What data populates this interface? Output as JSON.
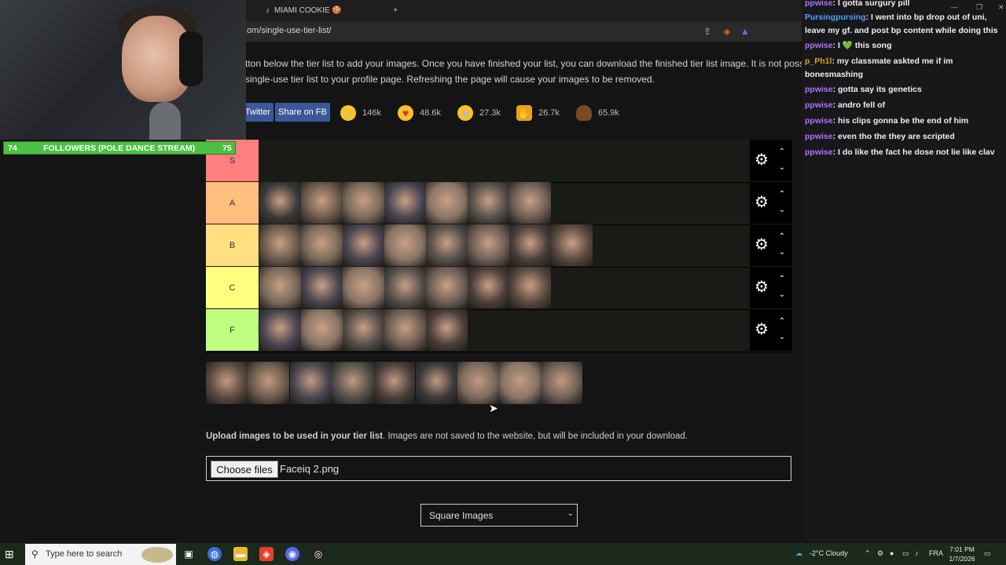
{
  "browser": {
    "tabs": [
      {
        "label": "MIAMI COOKIE 🍪 (@unbancookie)"
      }
    ],
    "url": "om/single-use-tier-list/"
  },
  "page": {
    "intro_line1": "tton below the tier list to add your images. Once you have finished your list, you can download the finished tier list image. It is not possible",
    "intro_line2": "single-use tier list to your profile page. Refreshing the page will cause your images to be removed.",
    "share_twitter": "Twitter",
    "share_fb": "Share on FB",
    "reactions": [
      {
        "icon": "smile-emoji-icon",
        "count": "146k"
      },
      {
        "icon": "heart-eyes-emoji-icon",
        "count": "48.6k"
      },
      {
        "icon": "laughing-emoji-icon",
        "count": "27.3k"
      },
      {
        "icon": "raised-hands-emoji-icon",
        "count": "26.7k"
      },
      {
        "icon": "poop-emoji-icon",
        "count": "65.9k"
      }
    ],
    "tiers": [
      {
        "label": "S",
        "color": "#ff7f7f",
        "count": 0
      },
      {
        "label": "A",
        "color": "#ffbf7f",
        "count": 7
      },
      {
        "label": "B",
        "color": "#ffdf7f",
        "count": 8
      },
      {
        "label": "C",
        "color": "#ffff7f",
        "count": 7
      },
      {
        "label": "F",
        "color": "#bfff7f",
        "count": 5
      }
    ],
    "pool_count": 9,
    "upload_bold": "Upload images to be used in your tier list",
    "upload_rest": ". Images are not saved to the website, but will be included in your download.",
    "choose_files": "Choose files",
    "file_name": "Faceiq 2.png",
    "image_shape": "Square Images"
  },
  "overlay": {
    "goal_left": "74",
    "goal_label": "FOLLOWERS (POLE DANCE STREAM)",
    "goal_right": "75"
  },
  "chat": [
    {
      "user": "ppwise",
      "color": "#b072ff",
      "text": ": I gotta surgury pill"
    },
    {
      "user": "Pursingpursing",
      "color": "#4aa3ff",
      "text": ": I went into bp drop out of uni, leave my gf. and post bp content while doing this"
    },
    {
      "user": "ppwise",
      "color": "#b072ff",
      "text": ": I 💚 this song"
    },
    {
      "user": "p_Ph1l",
      "color": "#e0a020",
      "text": ": my classmate askted me if im bonesmashing"
    },
    {
      "user": "ppwise",
      "color": "#b072ff",
      "text": ": gotta say its genetics"
    },
    {
      "user": "ppwise",
      "color": "#b072ff",
      "text": ": andro fell of"
    },
    {
      "user": "ppwise",
      "color": "#b072ff",
      "text": ": his clips gonna be the end of him"
    },
    {
      "user": "ppwise",
      "color": "#b072ff",
      "text": ": even tho the they are scripted"
    },
    {
      "user": "ppwise",
      "color": "#b072ff",
      "text": ": I do like the fact he dose not lie like clav"
    }
  ],
  "taskbar": {
    "search_placeholder": "Type here to search",
    "weather": "-2°C  Cloudy",
    "lang": "FRA",
    "time": "7:01 PM",
    "date": "1/7/2026"
  }
}
